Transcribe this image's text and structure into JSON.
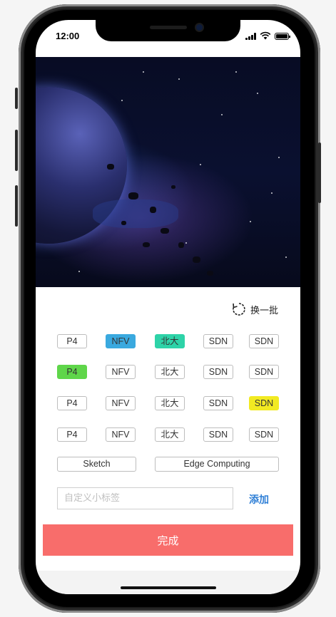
{
  "status_bar": {
    "time": "12:00",
    "icons": [
      "signal-icon",
      "wifi-icon",
      "battery-icon"
    ]
  },
  "hero": {
    "image": "space-asteroid-image"
  },
  "refresh": {
    "label": "换一批",
    "icon": "refresh-icon"
  },
  "tags": {
    "rows": [
      [
        {
          "label": "P4"
        },
        {
          "label": "NFV",
          "bg": "#3aa9df"
        },
        {
          "label": "北大",
          "bg": "#2ed3a8"
        },
        {
          "label": "SDN"
        },
        {
          "label": "SDN"
        }
      ],
      [
        {
          "label": "P4",
          "bg": "#5fd64a"
        },
        {
          "label": "NFV"
        },
        {
          "label": "北大"
        },
        {
          "label": "SDN"
        },
        {
          "label": "SDN"
        }
      ],
      [
        {
          "label": "P4"
        },
        {
          "label": "NFV"
        },
        {
          "label": "北大"
        },
        {
          "label": "SDN"
        },
        {
          "label": "SDN",
          "bg": "#f2ea22"
        }
      ],
      [
        {
          "label": "P4"
        },
        {
          "label": "NFV"
        },
        {
          "label": "北大"
        },
        {
          "label": "SDN"
        },
        {
          "label": "SDN"
        }
      ]
    ],
    "wide": [
      {
        "label": "Sketch"
      },
      {
        "label": "Edge Computing"
      }
    ]
  },
  "custom_tag": {
    "placeholder": "自定义小标签",
    "value": "",
    "add_label": "添加"
  },
  "done_button": {
    "label": "完成",
    "color": "#f86d6b"
  }
}
